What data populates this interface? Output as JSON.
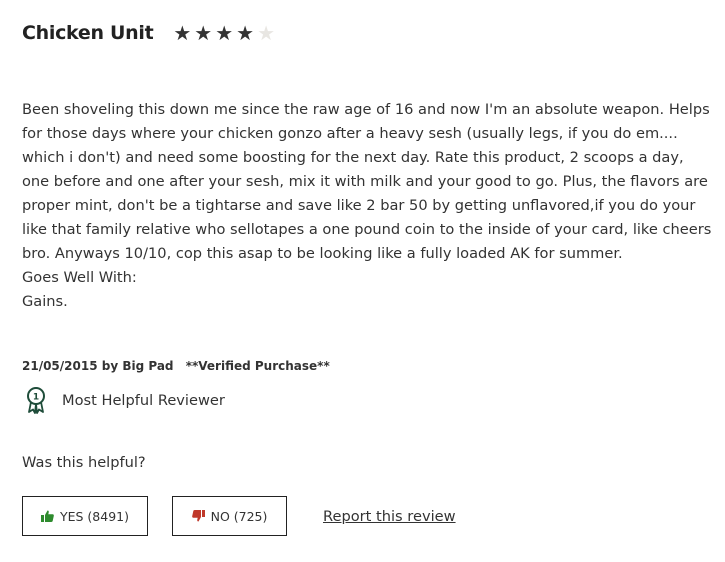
{
  "review": {
    "title": "Chicken Unit",
    "rating": 4,
    "max_rating": 5,
    "body_lines": [
      "Been shoveling this down me since the raw age of 16 and now I'm an absolute weapon. Helps for those days where your chicken gonzo after a heavy sesh (usually legs, if you do em.... which i don't) and need some boosting for the next day. Rate this product, 2 scoops a day, one before and one after your sesh, mix it with milk and your good to go. Plus, the flavors are proper mint, don't be a tightarse and save like 2 bar 50 by getting unflavored,if you do your like that family relative who sellotapes a one pound coin to the inside of your card, like cheers bro. Anyways 10/10, cop this asap to be looking like a fully loaded AK for summer.",
      "Goes Well With:",
      "Gains."
    ],
    "date_author": "21/05/2015 by Big Pad",
    "verified": "**Verified Purchase**",
    "badge": "Most Helpful Reviewer",
    "helpful_question": "Was this helpful?",
    "yes_label": "YES (8491)",
    "no_label": "NO (725)",
    "report_label": "Report this review"
  },
  "colors": {
    "yes_icon": "#2e8b2e",
    "no_icon": "#c0392b",
    "badge_icon": "#1f4d3a",
    "star_on": "#333333",
    "star_off": "#e8e6e2"
  },
  "icons": {
    "star": "star-icon",
    "badge": "award-ribbon-icon",
    "yes": "thumbs-up-icon",
    "no": "thumbs-down-icon"
  }
}
